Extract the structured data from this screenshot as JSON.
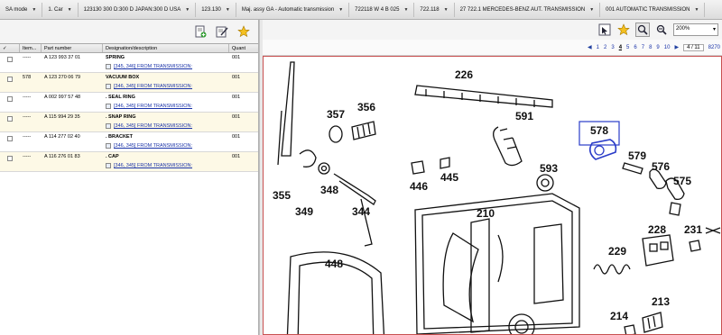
{
  "breadcrumbs": [
    {
      "label": "SA mode"
    },
    {
      "label": "1. Car"
    },
    {
      "label": "123130 300 D:300 D JAPAN:300 D USA"
    },
    {
      "label": "123.130"
    },
    {
      "label": "Maj. assy GA - Automatic transmission"
    },
    {
      "label": "722118 W 4 B 025"
    },
    {
      "label": "722.118"
    },
    {
      "label": "27 722.1 MERCEDES-BENZ AUT. TRANSMISSION"
    },
    {
      "label": "001 AUTOMATIC TRANSMISSION"
    }
  ],
  "left_toolbar": {
    "icons": [
      "add-to-list-icon",
      "edit-note-icon",
      "favorite-star-icon"
    ]
  },
  "table": {
    "headers": [
      "✓",
      "Item...",
      "Part number",
      "Designation/description",
      "Quant"
    ],
    "rows": [
      {
        "item": "-----",
        "part": "A 123 993 37 01",
        "desc": "SPRING",
        "link": "[345, 346] FROM TRANSMISSION:",
        "qty": "001"
      },
      {
        "item": "578",
        "part": "A 123 270 06 79",
        "desc": "VACUUM BOX",
        "link": "[346, 345] FROM TRANSMISSION:",
        "qty": "001"
      },
      {
        "item": "-----",
        "part": "A 002 997 57 48",
        "desc": ". SEAL RING",
        "link": "[346, 345] FROM TRANSMISSION:",
        "qty": "001"
      },
      {
        "item": "-----",
        "part": "A 115 994 29 35",
        "desc": ". SNAP RING",
        "link": "[346, 345] FROM TRANSMISSION:",
        "qty": "001"
      },
      {
        "item": "-----",
        "part": "A 114 277 02 40",
        "desc": ". BRACKET",
        "link": "[346, 345] FROM TRANSMISSION:",
        "qty": "001"
      },
      {
        "item": "-----",
        "part": "A 116 276 01 83",
        "desc": ". CAP",
        "link": "[346, 345] FROM TRANSMISSION:",
        "qty": "001"
      }
    ]
  },
  "right_toolbar": {
    "zoom": "200%"
  },
  "pager": {
    "pages": [
      "1",
      "2",
      "3",
      "4",
      "5",
      "6",
      "7",
      "8",
      "9",
      "10"
    ],
    "current": "4",
    "page_of": "4 / 11",
    "extra": "8270"
  },
  "drawing": {
    "labels": [
      "226",
      "578",
      "357",
      "356",
      "591",
      "579",
      "576",
      "593",
      "575",
      "355",
      "348",
      "349",
      "344",
      "446",
      "445",
      "210",
      "228",
      "231",
      "229",
      "448",
      "213",
      "214"
    ],
    "highlighted": "578",
    "highlight_color": "#2a3cc8"
  }
}
